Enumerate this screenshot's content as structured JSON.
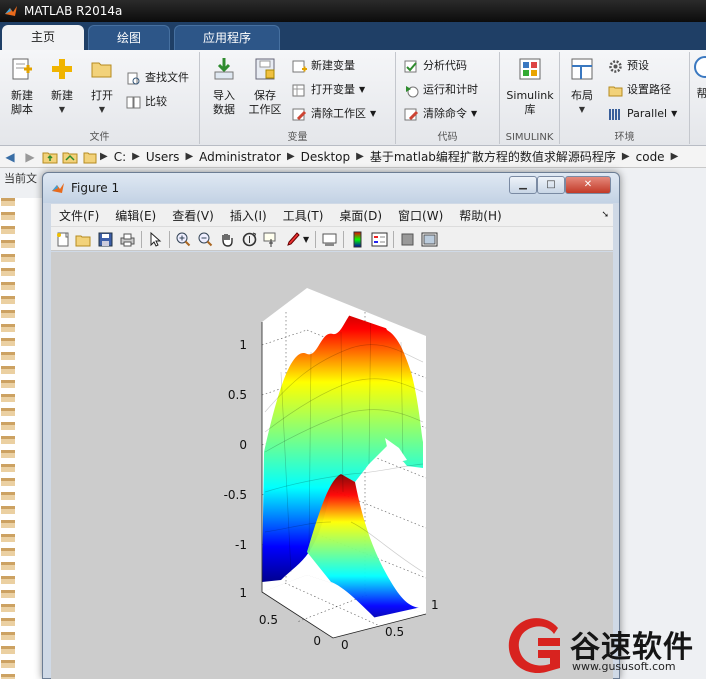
{
  "app": {
    "title": "MATLAB R2014a"
  },
  "tabs": [
    {
      "label": "主页"
    },
    {
      "label": "绘图"
    },
    {
      "label": "应用程序"
    }
  ],
  "ribbon": {
    "file": {
      "label": "文件",
      "new_script": [
        "新建",
        "脚本"
      ],
      "new": "新建",
      "open": "打开",
      "find_files": "查找文件",
      "compare": "比较"
    },
    "variable": {
      "label": "变量",
      "import": [
        "导入",
        "数据"
      ],
      "save": [
        "保存",
        "工作区"
      ],
      "new_var": "新建变量",
      "open_var": "打开变量",
      "clear_ws": "清除工作区"
    },
    "code": {
      "label": "代码",
      "analyze": "分析代码",
      "run_time": "运行和计时",
      "clear_cmd": "清除命令"
    },
    "simulink": {
      "label": "SIMULINK",
      "lib": [
        "Simulink",
        "库"
      ]
    },
    "env": {
      "label": "环境",
      "layout": "布局",
      "prefs": "预设",
      "set_path": "设置路径",
      "parallel": "Parallel",
      "help_cut": "帮"
    }
  },
  "address": {
    "crumbs": [
      "C:",
      "Users",
      "Administrator",
      "Desktop",
      "基于matlab编程扩散方程的数值求解源码程序",
      "code"
    ]
  },
  "current_folder": {
    "header": "当前文"
  },
  "figure": {
    "title": "Figure 1",
    "menus": [
      "文件(F)",
      "编辑(E)",
      "查看(V)",
      "插入(I)",
      "工具(T)",
      "桌面(D)",
      "窗口(W)",
      "帮助(H)"
    ]
  },
  "chart_data": {
    "type": "surface",
    "title": "",
    "zticks": [
      "1",
      "0.5",
      "0",
      "-0.5",
      "-1"
    ],
    "xticks": [
      "0",
      "0.5",
      "1"
    ],
    "yticks": [
      "0",
      "0.5",
      "1"
    ],
    "zlim": [
      -1,
      1
    ],
    "xlim": [
      0,
      1
    ],
    "ylim": [
      0,
      1
    ],
    "colormap": "jet",
    "grid": true
  },
  "watermark": {
    "title": "谷速软件",
    "url": "www.gususoft.com",
    "color": "#d8231f"
  }
}
